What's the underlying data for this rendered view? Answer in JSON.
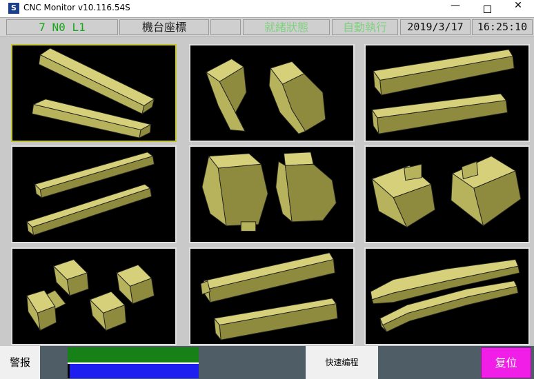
{
  "window": {
    "title": "CNC Monitor v10.116.54S",
    "app_icon_glyph": "S",
    "minimize_glyph": "—",
    "close_glyph": "✕"
  },
  "status": {
    "mode": "7 N0 L1",
    "coord_label": "機台座標",
    "blank": "",
    "ready_state": "就緒狀態",
    "auto_exec": "自動執行",
    "date": "2019/3/17",
    "time": "16:25:10"
  },
  "tiles": [
    {
      "name": "twisted-bars",
      "selected": true
    },
    {
      "name": "curved-channels",
      "selected": false
    },
    {
      "name": "straight-bars-slotted",
      "selected": false
    },
    {
      "name": "s-bent-bars",
      "selected": false
    },
    {
      "name": "barrel-blocks",
      "selected": false
    },
    {
      "name": "flared-blocks",
      "selected": false
    },
    {
      "name": "dumbbell-blocks",
      "selected": false
    },
    {
      "name": "square-bars",
      "selected": false
    },
    {
      "name": "tapered-rods",
      "selected": false
    }
  ],
  "bottom": {
    "alarm_label": "警报",
    "progress_top_fraction": 1.0,
    "progress_bottom_fraction": 1.0,
    "quick_program_label": "快速编程",
    "reset_label": "复位"
  },
  "colors": {
    "ok_green": "#17a817",
    "faded_green": "#7fd07f",
    "reset_magenta": "#f01ee6",
    "part_olive": "#b7b25c"
  }
}
